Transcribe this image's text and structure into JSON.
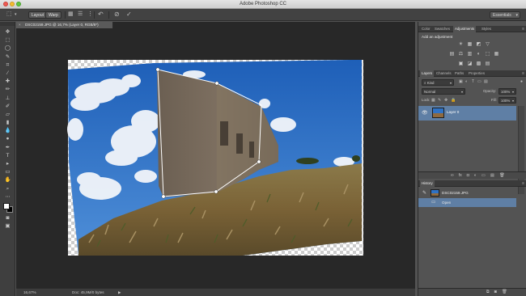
{
  "window": {
    "title": "Adobe Photoshop CC"
  },
  "options_bar": {
    "mode_layout": "Layout",
    "mode_warp": "Warp",
    "workspace": "Essentials",
    "icons": [
      "transform-icon",
      "reset-icon",
      "cancel-icon",
      "commit-icon"
    ]
  },
  "document": {
    "tab_close": "×",
    "tab_title": "DSC02159.JPG @ 16,7% (Layer 0, RGB/8*)"
  },
  "status_bar": {
    "zoom": "16,67%",
    "doc_size": "Doc: 45,9M/0 bytes",
    "arrow": "▶"
  },
  "adjustments_panel": {
    "tabs": [
      "Color",
      "Swatches",
      "Adjustments",
      "Styles"
    ],
    "active_tab": "Adjustments",
    "heading": "Add an adjustment",
    "icons_row1": [
      "☀",
      "▦",
      "◩",
      "▽"
    ],
    "icons_row2": [
      "▤",
      "⚖",
      "▥",
      "◐",
      "⬚",
      "▦"
    ],
    "icons_row3": [
      "▣",
      "◪",
      "▩",
      "▤"
    ]
  },
  "layers_panel": {
    "tabs": [
      "Layers",
      "Channels",
      "Paths",
      "Properties"
    ],
    "active_tab": "Layers",
    "filter": "Kind",
    "blend_mode": "Normal",
    "opacity_label": "Opacity:",
    "opacity_value": "100%",
    "lock_label": "Lock:",
    "fill_label": "Fill:",
    "fill_value": "100%",
    "layers": [
      {
        "name": "Layer 0",
        "visible": true,
        "selected": true
      }
    ]
  },
  "history_panel": {
    "title": "History",
    "snapshot": "DSC02159.JPG",
    "states": [
      {
        "name": "Open",
        "selected": true
      }
    ]
  },
  "colors": {
    "selection": "#5f7fa5",
    "panel_bg": "#535353",
    "canvas_bg": "#282828"
  }
}
